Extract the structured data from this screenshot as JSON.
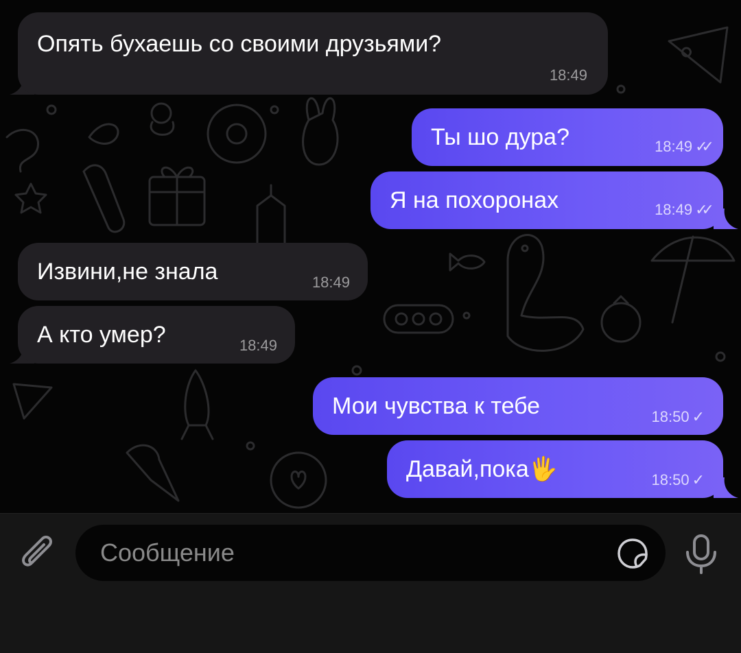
{
  "messages": [
    {
      "id": 1,
      "direction": "in",
      "text": "Опять бухаешь со своими друзьями?",
      "time": "18:49"
    },
    {
      "id": 2,
      "direction": "out",
      "text": "Ты шо дура?",
      "time": "18:49",
      "status": "read"
    },
    {
      "id": 3,
      "direction": "out",
      "text": "Я на похоронах",
      "time": "18:49",
      "status": "read"
    },
    {
      "id": 4,
      "direction": "in",
      "text": "Извини,не знала",
      "time": "18:49"
    },
    {
      "id": 5,
      "direction": "in",
      "text": "А кто умер?",
      "time": "18:49"
    },
    {
      "id": 6,
      "direction": "out",
      "text": "Мои чувства к тебе",
      "time": "18:50",
      "status": "sent"
    },
    {
      "id": 7,
      "direction": "out",
      "text": "Давай,пока🖐",
      "time": "18:50",
      "status": "sent"
    }
  ],
  "status_glyphs": {
    "read": "✓✓",
    "sent": "✓"
  },
  "composer": {
    "placeholder": "Сообщение",
    "attach_icon": "paperclip-icon",
    "sticker_icon": "sticker-icon",
    "mic_icon": "microphone-icon"
  },
  "theme": {
    "incoming_bubble": "#222024",
    "outgoing_bubble": "#6552f4",
    "background": "#050505"
  }
}
